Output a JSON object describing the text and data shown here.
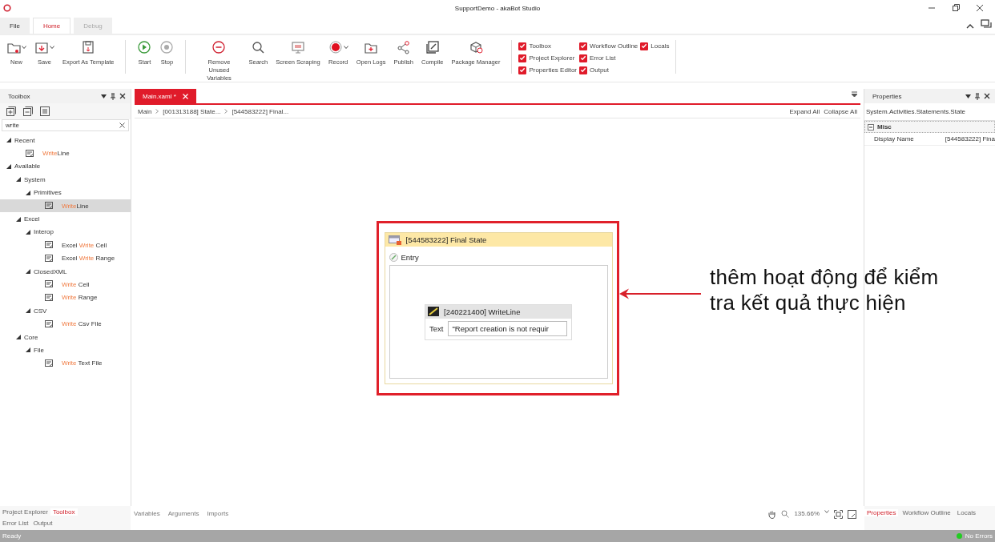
{
  "window": {
    "title": "SupportDemo - akaBot Studio"
  },
  "menu_tabs": [
    {
      "label": "File",
      "selected": false
    },
    {
      "label": "Home",
      "selected": true
    },
    {
      "label": "Debug",
      "selected": false
    }
  ],
  "ribbon": {
    "groups": [
      {
        "buttons": [
          {
            "label": "New",
            "dropdown": true
          },
          {
            "label": "Save",
            "dropdown": true
          },
          {
            "label": "Export As Template",
            "dropdown": false
          }
        ]
      },
      {
        "buttons": [
          {
            "label": "Start",
            "dropdown": false
          },
          {
            "label": "Stop",
            "dropdown": false
          }
        ]
      },
      {
        "buttons": [
          {
            "label": "Remove Unused Variables",
            "dropdown": false
          },
          {
            "label": "Search",
            "dropdown": false
          },
          {
            "label": "Screen Scraping",
            "dropdown": false
          },
          {
            "label": "Record",
            "dropdown": true
          },
          {
            "label": "Open Logs",
            "dropdown": false
          },
          {
            "label": "Publish",
            "dropdown": false
          },
          {
            "label": "Compile",
            "dropdown": false
          },
          {
            "label": "Package Manager",
            "dropdown": false
          }
        ]
      }
    ],
    "panel_toggles": [
      {
        "label": "Toolbox",
        "checked": true
      },
      {
        "label": "Project Explorer",
        "checked": true
      },
      {
        "label": "Properties Editor",
        "checked": true
      },
      {
        "label": "Workflow Outline",
        "checked": true
      },
      {
        "label": "Error List",
        "checked": true
      },
      {
        "label": "Output",
        "checked": true
      },
      {
        "label": "Locals",
        "checked": true
      }
    ]
  },
  "toolbox": {
    "title": "Toolbox",
    "search": {
      "value": "write"
    },
    "tree": [
      {
        "label": "Recent",
        "expanded": true,
        "children": [
          {
            "match": "Write",
            "suffix": "Line",
            "selected": false
          }
        ]
      },
      {
        "label": "Available",
        "expanded": true,
        "children": [
          {
            "label": "System",
            "expanded": true,
            "children": [
              {
                "label": "Primitives",
                "expanded": true,
                "children": [
                  {
                    "match": "Write",
                    "suffix": "Line",
                    "selected": true
                  }
                ]
              }
            ]
          },
          {
            "label": "Excel",
            "expanded": true,
            "children": [
              {
                "label": "Interop",
                "expanded": true,
                "children": [
                  {
                    "prefix": "Excel ",
                    "match": "Write",
                    "suffix": " Cell",
                    "selected": false
                  },
                  {
                    "prefix": "Excel ",
                    "match": "Write",
                    "suffix": " Range",
                    "selected": false
                  }
                ]
              },
              {
                "label": "ClosedXML",
                "expanded": true,
                "children": [
                  {
                    "match": "Write",
                    "suffix": " Cell",
                    "selected": false
                  },
                  {
                    "match": "Write",
                    "suffix": " Range",
                    "selected": false
                  }
                ]
              },
              {
                "label": "CSV",
                "expanded": true,
                "children": [
                  {
                    "match": "Write",
                    "suffix": " Csv File",
                    "selected": false
                  }
                ]
              }
            ]
          },
          {
            "label": "Core",
            "expanded": true,
            "children": [
              {
                "label": "File",
                "expanded": true,
                "children": [
                  {
                    "match": "Write",
                    "suffix": " Text File",
                    "selected": false
                  }
                ]
              }
            ]
          }
        ]
      }
    ]
  },
  "document_tabs": [
    {
      "label": "Main.xaml *",
      "selected": true
    }
  ],
  "breadcrumb": [
    "Main",
    "[001313188] State...",
    "[544583222] Final..."
  ],
  "canvas_actions": [
    "Expand All",
    "Collapse All"
  ],
  "state": {
    "title": "[544583222] Final State",
    "section": "Entry",
    "activity": {
      "title": "[240221400] WriteLine",
      "field_label": "Text",
      "field_value": "\"Report creation is not requir"
    }
  },
  "annotation": {
    "text": "thêm hoạt động để kiểm\ntra kết quả thực hiện"
  },
  "properties": {
    "title": "Properties",
    "type_name": "System.Activities.Statements.State",
    "category": {
      "label": "Misc",
      "expanded": true
    },
    "rows": [
      {
        "name": "Display Name",
        "value": "[544583222] Fina"
      }
    ]
  },
  "left_bottom_tabs": [
    [
      {
        "label": "Project Explorer",
        "selected": false
      },
      {
        "label": "Toolbox",
        "selected": true
      }
    ],
    [
      {
        "label": "Error List",
        "selected": false
      },
      {
        "label": "Output",
        "selected": false
      }
    ]
  ],
  "canvas_bottom_tabs": [
    "Variables",
    "Arguments",
    "Imports"
  ],
  "zoom": "135.66%",
  "right_bottom_tabs": [
    {
      "label": "Properties",
      "selected": true
    },
    {
      "label": "Workflow Outline",
      "selected": false
    },
    {
      "label": "Locals",
      "selected": false
    }
  ],
  "status_bar": {
    "text": "Ready",
    "errors": "No Errors",
    "ok": true
  }
}
